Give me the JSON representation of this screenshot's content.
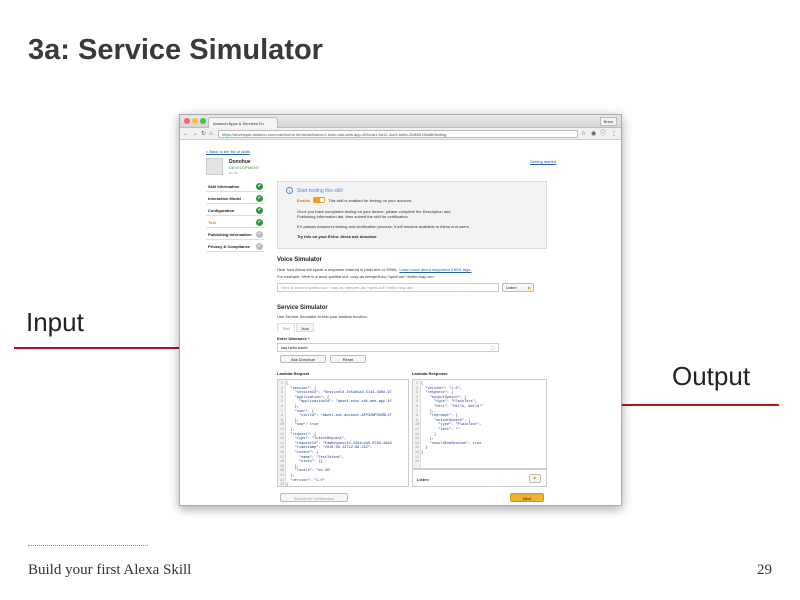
{
  "slide": {
    "title": "3a: Service Simulator",
    "input_label": "Input",
    "output_label": "Output",
    "footer": "Build your first Alexa Skill",
    "page_number": "29"
  },
  "colors": {
    "arrow": "#b0151a",
    "accent_orange": "#f0a020",
    "success_green": "#2e9a3c"
  },
  "browser": {
    "tab_title": "Amazon Apps & Services D×",
    "profile": "Brian",
    "url_scheme": "https://",
    "url_rest": "developer.amazon.com/edw/home.html#/skill/amzn1.echo-sdk-ams.app.4f2fcda1-5a12-4ce3-a46b-2fd665155d8f/testing"
  },
  "sidebar": {
    "back_link": "< Back to the list of skills",
    "skill_name": "Donohue",
    "skill_status": "DEVELOPMENT",
    "skill_lang": "en-US",
    "items": [
      {
        "label": "Skill Information",
        "done": true
      },
      {
        "label": "Interaction Model",
        "done": true
      },
      {
        "label": "Configuration",
        "done": true
      },
      {
        "label": "Test",
        "done": true
      },
      {
        "label": "Publishing Information",
        "done": false
      },
      {
        "label": "Privacy & Compliance",
        "done": false
      }
    ],
    "getting_started": "Getting started"
  },
  "testing_box": {
    "heading": "Start testing this skill",
    "enable_label": "Enable",
    "enable_text": "This skill is enabled for testing on your account.",
    "para1": "Once you have completed testing on your device, please complete the Description and",
    "para1b": "Publishing Information tab, then submit the skill for certification.",
    "para2": "If it passes Amazon's testing and certification process, it will become available to Alexa end users.",
    "try_text": "Try this on your Echo: Alexa ask donohue"
  },
  "voice_simulator": {
    "title": "Voice Simulator",
    "desc": "Hear how Alexa will speak a response entered in plain text or SSML.",
    "desc_link": "Learn more about supported SSML tags.",
    "example": "For example: Here is a word spelled out: <say-as interpret-as=\"spell-out\">hello</say-as>.",
    "placeholder": "Here is a word spelled out: <say-as interpret-as=\"spell-out\">hello</say-as>",
    "listen": "Listen"
  },
  "service_simulator": {
    "title": "Service Simulator",
    "desc": "Use Service Simulator to test your lambda function.",
    "tab_text": "Text",
    "tab_json": "Json",
    "utterance_label": "Enter Utterance *",
    "utterance_value": "say hello world",
    "ask_button": "Ask Donohue",
    "reset_button": "Reset",
    "request_title": "Lambda Request",
    "response_title": "Lambda Response",
    "request_lines": [
      "{",
      "  \"session\": {",
      "    \"sessionId\": \"SessionId.1b5a64a2-5143-498d-97",
      "    \"application\": {",
      "      \"applicationId\": \"amzn1.echo-sdk-ams.app.4f",
      "    },",
      "    \"user\": {",
      "      \"userId\": \"amzn1.ask.account.AFP3ZWPOS2BL2T",
      "    },",
      "    \"new\": true",
      "  },",
      "  \"request\": {",
      "    \"type\": \"IntentRequest\",",
      "    \"requestId\": \"EdwRequestId.1301c2a0-0799-49e6",
      "    \"timestamp\": \"2016-09-12T22:09:25Z\",",
      "    \"intent\": {",
      "      \"name\": \"TestIntent\",",
      "      \"slots\": {}",
      "    },",
      "    \"locale\": \"en-US\"",
      "  },",
      "  \"version\": \"1.0\"",
      "}"
    ],
    "response_lines": [
      "{",
      "  \"version\": \"1.0\",",
      "  \"response\": {",
      "    \"outputSpeech\": {",
      "      \"type\": \"PlainText\",",
      "      \"text\": \"Hello, World!\"",
      "    },",
      "    \"reprompt\": {",
      "      \"outputSpeech\": {",
      "        \"type\": \"PlainText\",",
      "        \"text\": \"\"",
      "      }",
      "    },",
      "    \"shouldEndSession\": true",
      "  }",
      "}",
      "",
      ""
    ],
    "listen": "Listen"
  },
  "footer_buttons": {
    "submit": "Submit for Certification",
    "next": "Next"
  }
}
